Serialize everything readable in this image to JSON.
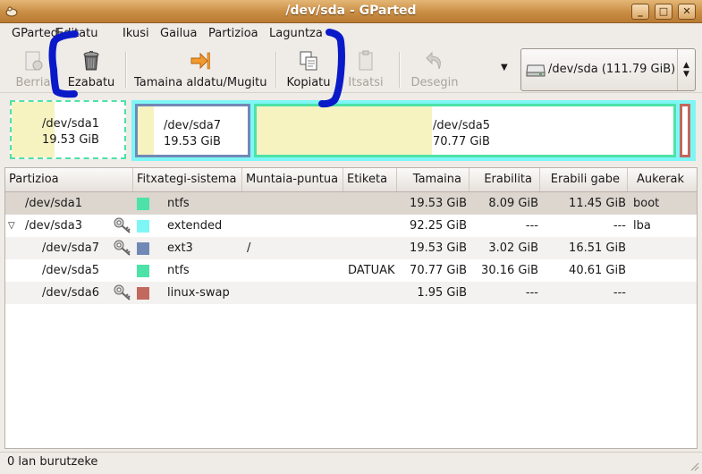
{
  "window": {
    "title": "/dev/sda - GParted"
  },
  "menu": [
    "GParted",
    "Editatu",
    "Ikusi",
    "Gailua",
    "Partizioa",
    "Laguntza"
  ],
  "toolbar": {
    "berria": "Berria",
    "ezabatu": "Ezabatu",
    "tamaina": "Tamaina aldatu/Mugitu",
    "kopiatu": "Kopiatu",
    "itsatsi": "Itsatsi",
    "desegin": "Desegin"
  },
  "device": {
    "label": "/dev/sda   (111.79 GiB)"
  },
  "disk_map": [
    {
      "name": "/dev/sda1",
      "size": "19.53 GiB"
    },
    {
      "name": "/dev/sda7",
      "size": "19.53 GiB"
    },
    {
      "name": "/dev/sda5",
      "size": "70.77 GiB"
    }
  ],
  "table": {
    "headers": [
      "Partizioa",
      "Fitxategi-sistema",
      "Muntaia-puntua",
      "Etiketa",
      "Tamaina",
      "Erabilita",
      "Erabili gabe",
      "Aukerak"
    ],
    "rows": [
      {
        "partition": "/dev/sda1",
        "filesystem": "ntfs",
        "mount": "",
        "label": "",
        "size": "19.53 GiB",
        "used": "8.09 GiB",
        "unused": "11.45 GiB",
        "flags": "boot"
      },
      {
        "partition": "/dev/sda3",
        "filesystem": "extended",
        "mount": "",
        "label": "",
        "size": "92.25 GiB",
        "used": "---",
        "unused": "---",
        "flags": "lba"
      },
      {
        "partition": "/dev/sda7",
        "filesystem": "ext3",
        "mount": "/",
        "label": "",
        "size": "19.53 GiB",
        "used": "3.02 GiB",
        "unused": "16.51 GiB",
        "flags": ""
      },
      {
        "partition": "/dev/sda5",
        "filesystem": "ntfs",
        "mount": "",
        "label": "DATUAK",
        "size": "70.77 GiB",
        "used": "30.16 GiB",
        "unused": "40.61 GiB",
        "flags": ""
      },
      {
        "partition": "/dev/sda6",
        "filesystem": "linux-swap",
        "mount": "",
        "label": "",
        "size": "1.95 GiB",
        "used": "---",
        "unused": "---",
        "flags": ""
      }
    ]
  },
  "colors": {
    "ntfs": "#4de2a8",
    "extended": "#7ef6f6",
    "ext3": "#7189b6",
    "linux_swap": "#c2695e"
  },
  "status": "0 lan burutzeke"
}
